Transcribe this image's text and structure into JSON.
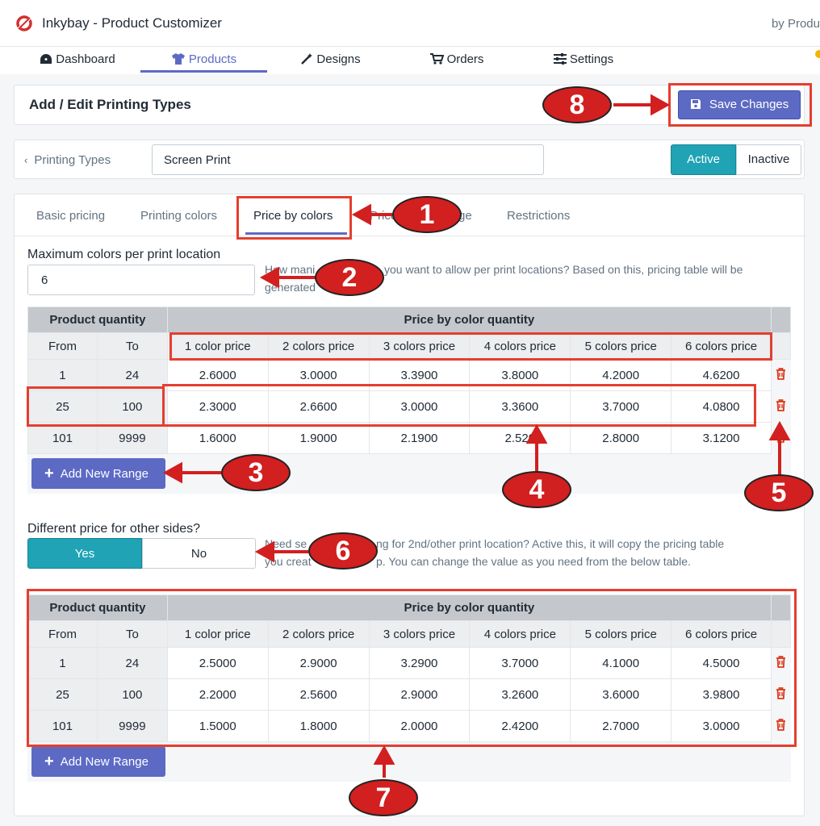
{
  "app": {
    "title": "Inkybay - Product Customizer",
    "byline": "by Produ"
  },
  "nav": [
    {
      "label": "Dashboard",
      "icon": "dashboard-icon"
    },
    {
      "label": "Products",
      "icon": "tshirt-icon",
      "active": true
    },
    {
      "label": "Designs",
      "icon": "magic-wand-icon"
    },
    {
      "label": "Orders",
      "icon": "cart-icon"
    },
    {
      "label": "Settings",
      "icon": "sliders-icon"
    }
  ],
  "header": {
    "title": "Add / Edit Printing Types",
    "save_label": "Save Changes"
  },
  "toolbar": {
    "back_label": "Printing Types",
    "name_value": "Screen Print",
    "status": {
      "active": "Active",
      "inactive": "Inactive",
      "selected": "Active"
    }
  },
  "tabs": [
    "Basic pricing",
    "Printing colors",
    "Price by colors",
    "Price",
    "ge",
    "Restrictions"
  ],
  "max_colors": {
    "label": "Maximum colors per print location",
    "value": "6",
    "help_a": "How mani",
    "help_b": "you want to allow per print locations? Based on this, pricing table will be",
    "help_c": "generated"
  },
  "table_headers": {
    "qty_group": "Product quantity",
    "price_group": "Price by color quantity",
    "from": "From",
    "to": "To",
    "cols": [
      "1 color price",
      "2 colors price",
      "3 colors price",
      "4 colors price",
      "5 colors price",
      "6 colors price"
    ]
  },
  "table1": [
    {
      "from": "1",
      "to": "24",
      "prices": [
        "2.6000",
        "3.0000",
        "3.3900",
        "3.8000",
        "4.2000",
        "4.6200"
      ]
    },
    {
      "from": "25",
      "to": "100",
      "prices": [
        "2.3000",
        "2.6600",
        "3.0000",
        "3.3600",
        "3.7000",
        "4.0800"
      ]
    },
    {
      "from": "101",
      "to": "9999",
      "prices": [
        "1.6000",
        "1.9000",
        "2.1900",
        "2.520",
        "2.8000",
        "3.1200"
      ]
    }
  ],
  "add_range_label": "Add New Range",
  "other_sides": {
    "label": "Different price for other sides?",
    "yes": "Yes",
    "no": "No",
    "selected": "Yes",
    "help_a": "Need se",
    "help_b": "ng for 2nd/other print location? Active this, it will copy the pricing table",
    "help_c": "you creat",
    "help_d": "p. You can change the value as you need from the below table."
  },
  "table2": [
    {
      "from": "1",
      "to": "24",
      "prices": [
        "2.5000",
        "2.9000",
        "3.2900",
        "3.7000",
        "4.1000",
        "4.5000"
      ]
    },
    {
      "from": "25",
      "to": "100",
      "prices": [
        "2.2000",
        "2.5600",
        "2.9000",
        "3.2600",
        "3.6000",
        "3.9800"
      ]
    },
    {
      "from": "101",
      "to": "9999",
      "prices": [
        "1.5000",
        "1.8000",
        "2.0000",
        "2.4200",
        "2.7000",
        "3.0000"
      ]
    }
  ],
  "callouts": [
    "1",
    "2",
    "3",
    "4",
    "5",
    "6",
    "7",
    "8"
  ],
  "colors": {
    "accent": "#5c6ac4",
    "teal": "#1fa3b5",
    "annotation_red": "#d21f1f",
    "delete_red": "#de3618"
  }
}
